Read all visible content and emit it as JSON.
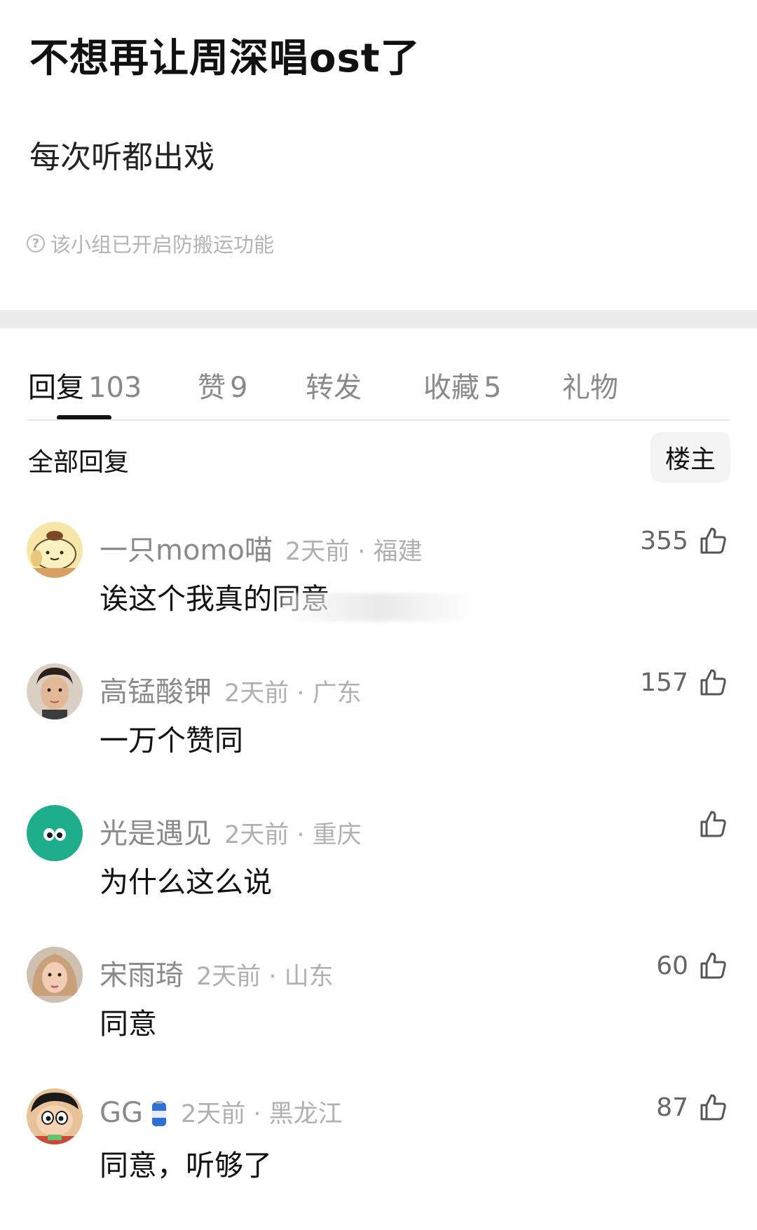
{
  "post": {
    "title": "不想再让周深唱ost了",
    "body": "每次听都出戏",
    "notice": "该小组已开启防搬运功能"
  },
  "tabs": [
    {
      "label": "回复",
      "count": "103",
      "active": true
    },
    {
      "label": "赞",
      "count": "9",
      "active": false
    },
    {
      "label": "转发",
      "count": "",
      "active": false
    },
    {
      "label": "收藏",
      "count": "5",
      "active": false
    },
    {
      "label": "礼物",
      "count": "",
      "active": false
    }
  ],
  "filter": {
    "label": "全部回复",
    "op_button": "楼主"
  },
  "comments": [
    {
      "user": "一只momo喵",
      "meta": "2天前 · 福建",
      "text": "诶这个我真的同意",
      "likes": "355",
      "avatar_icon": "pudding-dog-avatar-icon"
    },
    {
      "user": "高锰酸钾",
      "meta": "2天前 · 广东",
      "text": "一万个赞同",
      "likes": "157",
      "avatar_icon": "portrait-avatar-icon"
    },
    {
      "user": "光是遇见",
      "meta": "2天前 · 重庆",
      "text": "为什么这么说",
      "likes": "",
      "avatar_icon": "green-eyes-avatar-icon"
    },
    {
      "user": "宋雨琦",
      "meta": "2天前 · 山东",
      "text": "同意",
      "likes": "60",
      "avatar_icon": "portrait-avatar-icon"
    },
    {
      "user": "GG",
      "meta": "2天前 · 黑龙江",
      "text": "同意，听够了",
      "likes": "87",
      "avatar_icon": "cartoon-boy-avatar-icon"
    }
  ],
  "colors": {
    "accent_green": "#1fae8c",
    "divider": "#ececec",
    "muted_text": "#8a8a8a"
  }
}
